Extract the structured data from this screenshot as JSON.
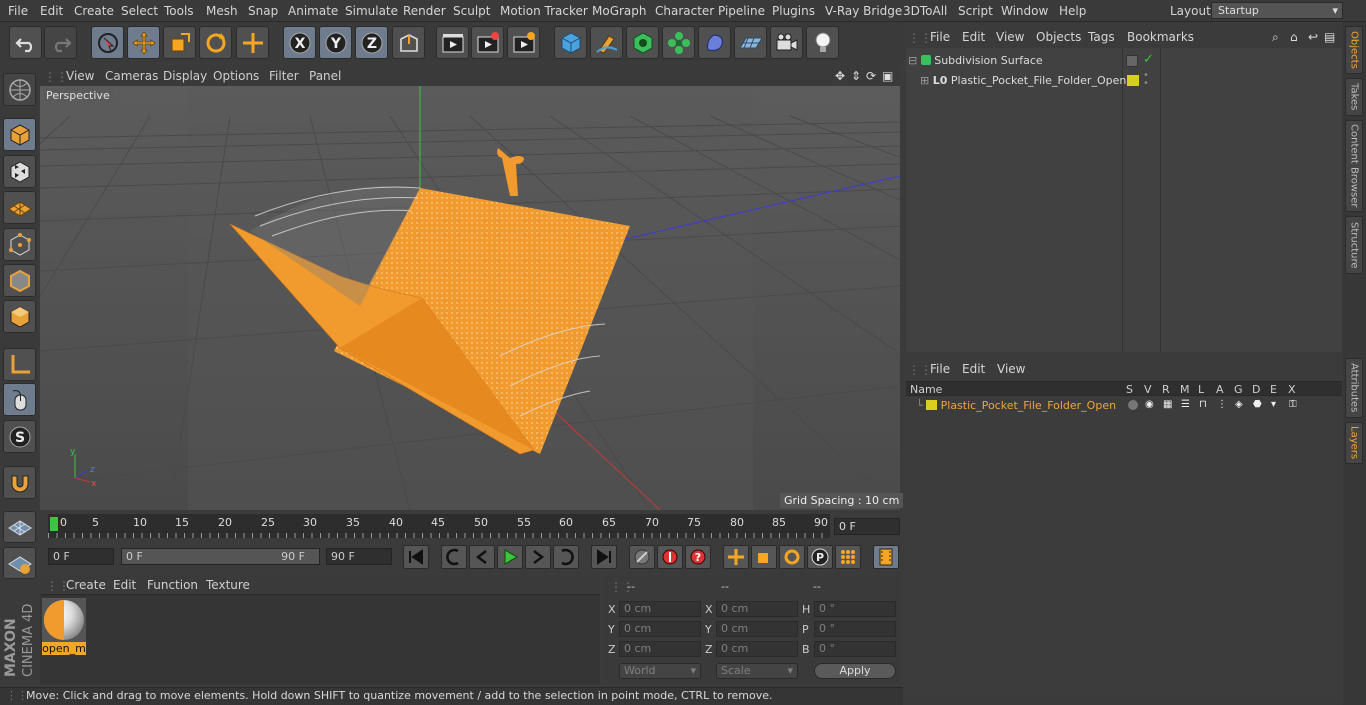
{
  "menubar": {
    "items": [
      "File",
      "Edit",
      "Create",
      "Select",
      "Tools",
      "Mesh",
      "Snap",
      "Animate",
      "Simulate",
      "Render",
      "Sculpt",
      "Motion Tracker",
      "MoGraph",
      "Character",
      "Pipeline",
      "Plugins",
      "V-Ray Bridge",
      "3DToAll",
      "Script",
      "Window",
      "Help"
    ],
    "layout_label": "Layout:",
    "layout_value": "Startup"
  },
  "toolbar": {
    "icons": [
      "undo-icon",
      "redo-icon",
      "select-icon",
      "move-icon",
      "scale-icon",
      "rotate-icon",
      "move-live-icon",
      "x-axis-icon",
      "y-axis-icon",
      "z-axis-icon",
      "coordinate-system-icon",
      "render-view-icon",
      "render-picture-viewer-icon",
      "render-settings-icon",
      "cube-icon",
      "pen-icon",
      "subdivision-icon",
      "cloner-icon",
      "deformer-icon",
      "floor-icon",
      "camera-icon",
      "light-icon"
    ]
  },
  "left_toolbar": {
    "icons": [
      "make-editable-icon",
      "model-mode-icon",
      "texture-mode-icon",
      "workplane-icon",
      "points-mode-icon",
      "edges-mode-icon",
      "polygons-mode-icon",
      "axis-mode-icon",
      "tweak-icon",
      "solo-icon",
      "snap-magnet-icon"
    ]
  },
  "viewport": {
    "menu": [
      "View",
      "Cameras",
      "Display",
      "Options",
      "Filter",
      "Panel"
    ],
    "camera_label": "Perspective",
    "grid_spacing": "Grid Spacing : 10 cm",
    "axis_labels": [
      "y",
      "z",
      "x"
    ]
  },
  "timeline": {
    "ticks": [
      "0",
      "5",
      "10",
      "15",
      "20",
      "25",
      "30",
      "35",
      "40",
      "45",
      "50",
      "55",
      "60",
      "65",
      "70",
      "75",
      "80",
      "85",
      "90"
    ],
    "current_frame": "0 F"
  },
  "playback": {
    "start_field": "0 F",
    "range_start": "0 F",
    "range_end": "90 F",
    "end_field": "90 F"
  },
  "material_manager": {
    "menu": [
      "Create",
      "Edit",
      "Function",
      "Texture"
    ],
    "material_name": "open_m"
  },
  "coordinates": {
    "headers": [
      "--",
      "--",
      "--"
    ],
    "rows": [
      {
        "l1": "X",
        "v1": "0 cm",
        "l2": "X",
        "v2": "0 cm",
        "l3": "H",
        "v3": "0 °"
      },
      {
        "l1": "Y",
        "v1": "0 cm",
        "l2": "Y",
        "v2": "0 cm",
        "l3": "P",
        "v3": "0 °"
      },
      {
        "l1": "Z",
        "v1": "0 cm",
        "l2": "Z",
        "v2": "0 cm",
        "l3": "B",
        "v3": "0 °"
      }
    ],
    "world": "World",
    "scale": "Scale",
    "apply": "Apply"
  },
  "status": "Move: Click and drag to move elements. Hold down SHIFT to quantize movement / add to the selection in point mode, CTRL to remove.",
  "object_manager": {
    "menu": [
      "File",
      "Edit",
      "View",
      "Objects",
      "Tags",
      "Bookmarks"
    ],
    "objects": [
      "Subdivision Surface",
      "Plastic_Pocket_File_Folder_Open"
    ]
  },
  "layer_manager": {
    "menu": [
      "File",
      "Edit",
      "View"
    ],
    "columns": [
      "Name",
      "S",
      "V",
      "R",
      "M",
      "L",
      "A",
      "G",
      "D",
      "E",
      "X"
    ],
    "layers": [
      "Plastic_Pocket_File_Folder_Open"
    ],
    "layer_color": "#d8d020"
  },
  "side_tabs": [
    "Objects",
    "Takes",
    "Content Browser",
    "Structure",
    "Attributes",
    "Layers"
  ],
  "logo": {
    "brand": "MAXON",
    "product": "CINEMA 4D"
  },
  "colors": {
    "accent": "#f0a53a",
    "selection": "#6e7c8e",
    "model": "#f59a30"
  }
}
